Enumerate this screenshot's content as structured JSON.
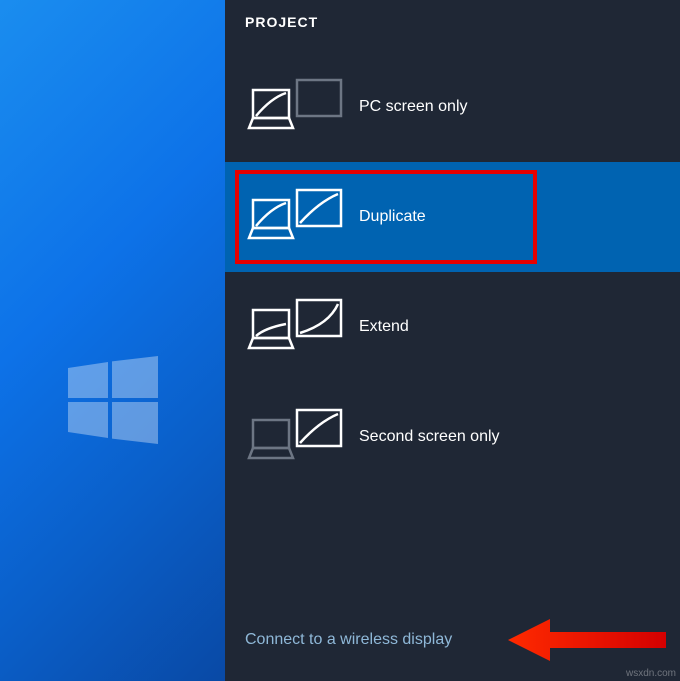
{
  "panel": {
    "title": "PROJECT",
    "options": [
      {
        "label": "PC screen only"
      },
      {
        "label": "Duplicate"
      },
      {
        "label": "Extend"
      },
      {
        "label": "Second screen only"
      }
    ],
    "wireless_link": "Connect to a wireless display"
  },
  "watermark": "wsxdn.com"
}
